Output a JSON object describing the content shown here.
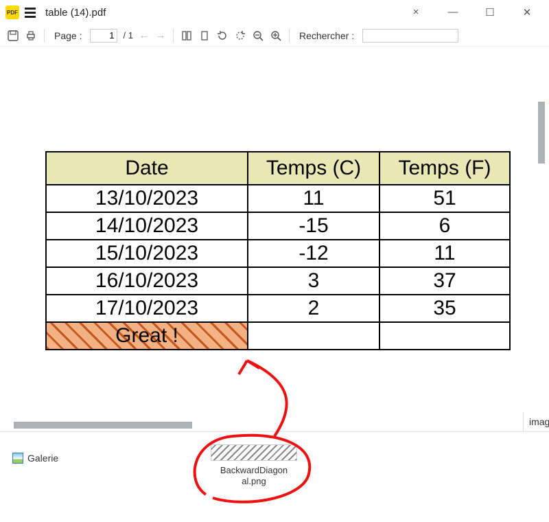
{
  "window": {
    "title": "table (14).pdf",
    "app_badge": "PDF"
  },
  "toolbar": {
    "page_label": "Page :",
    "page_current": "1",
    "page_total": "/ 1",
    "search_label": "Rechercher :",
    "search_placeholder": ""
  },
  "table": {
    "headers": {
      "date": "Date",
      "c": "Temps (C)",
      "f": "Temps (F)"
    },
    "rows": [
      {
        "date": "13/10/2023",
        "c": "11",
        "f": "51"
      },
      {
        "date": "14/10/2023",
        "c": "-15",
        "f": "6"
      },
      {
        "date": "15/10/2023",
        "c": "-12",
        "f": "11"
      },
      {
        "date": "16/10/2023",
        "c": "3",
        "f": "37"
      },
      {
        "date": "17/10/2023",
        "c": "2",
        "f": "35"
      }
    ],
    "footer": {
      "date": "Great !",
      "c": "",
      "f": ""
    }
  },
  "desktop": {
    "galerie_label": "Galerie",
    "file_name_line1": "BackwardDiagon",
    "file_name_line2": "al.png"
  },
  "side_fragment": "imag"
}
